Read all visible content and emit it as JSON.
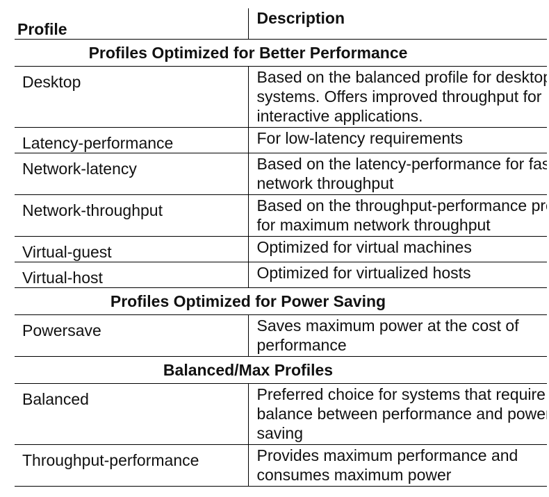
{
  "header": {
    "profile": "Profile",
    "description": "Description"
  },
  "sections": [
    {
      "title": "Profiles Optimized for Better Performance",
      "rows": [
        {
          "name": "Desktop",
          "description": "Based on the balanced profile for desktop\nsystems. Offers improved throughput for\ninteractive applications."
        },
        {
          "name": "Latency-performance",
          "description": "For low-latency requirements"
        },
        {
          "name": "Network-latency",
          "description": "Based on the latency-performance for faster\nnetwork throughput"
        },
        {
          "name": "Network-throughput",
          "description": "Based on the throughput-performance profile\nfor maximum network throughput"
        },
        {
          "name": "Virtual-guest",
          "description": "Optimized for virtual machines"
        },
        {
          "name": "Virtual-host",
          "description": "Optimized for virtualized hosts"
        }
      ]
    },
    {
      "title": "Profiles Optimized for Power Saving",
      "rows": [
        {
          "name": "Powersave",
          "description": "Saves maximum power at the cost of\nperformance"
        }
      ]
    },
    {
      "title": "Balanced/Max Profiles",
      "rows": [
        {
          "name": "Balanced",
          "description": "Preferred choice for systems that require a\nbalance between performance and power\nsaving"
        },
        {
          "name": "Throughput-performance",
          "description": "Provides maximum performance and\nconsumes maximum power"
        }
      ]
    }
  ]
}
